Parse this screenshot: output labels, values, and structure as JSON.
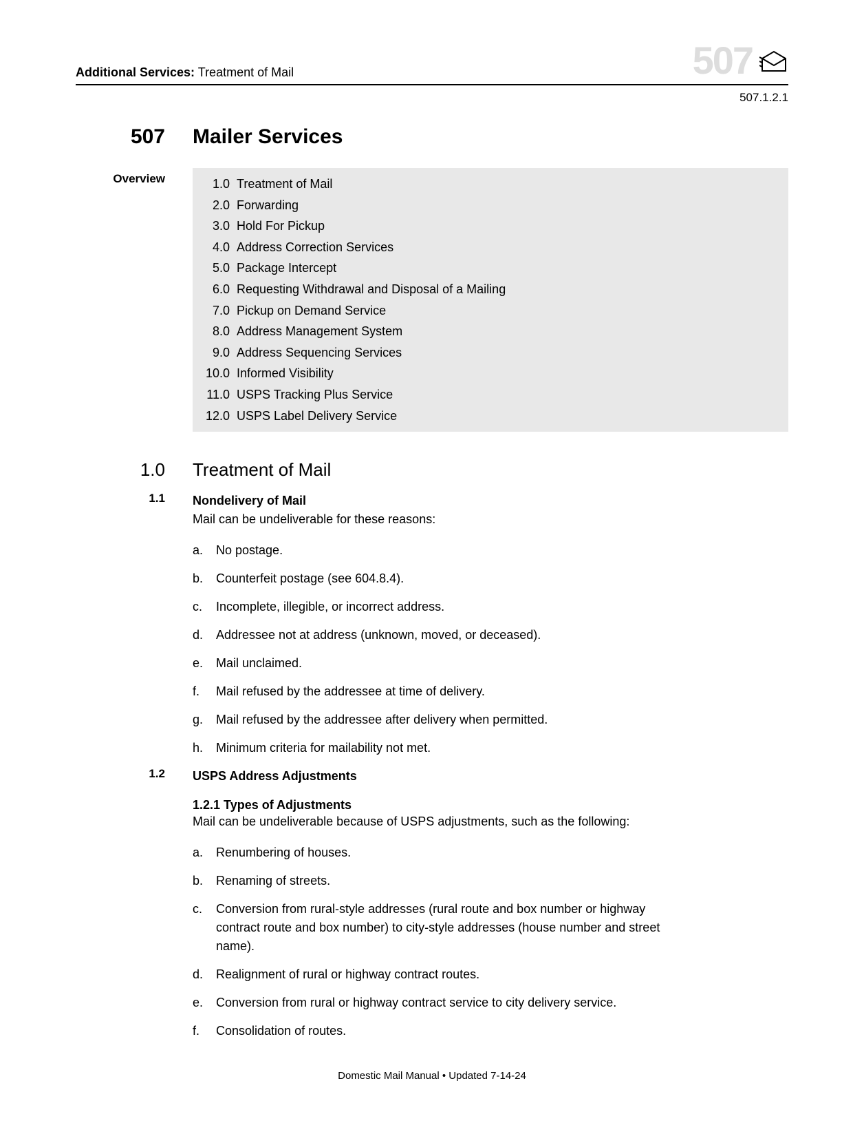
{
  "header": {
    "category_bold": "Additional Services:",
    "category_rest": " Treatment of Mail",
    "big_number": "507",
    "section_ref": "507.1.2.1"
  },
  "chapter": {
    "number": "507",
    "title": "Mailer Services"
  },
  "overview": {
    "label": "Overview",
    "items": [
      {
        "num": "1.0",
        "text": "Treatment of Mail"
      },
      {
        "num": "2.0",
        "text": "Forwarding"
      },
      {
        "num": "3.0",
        "text": "Hold For Pickup"
      },
      {
        "num": "4.0",
        "text": "Address Correction Services"
      },
      {
        "num": "5.0",
        "text": "Package Intercept"
      },
      {
        "num": "6.0",
        "text": "Requesting Withdrawal and Disposal of a Mailing"
      },
      {
        "num": "7.0",
        "text": "Pickup on Demand Service"
      },
      {
        "num": "8.0",
        "text": "Address Management System"
      },
      {
        "num": "9.0",
        "text": "Address Sequencing Services"
      },
      {
        "num": "10.0",
        "text": "Informed Visibility"
      },
      {
        "num": "11.0",
        "text": "USPS Tracking Plus Service"
      },
      {
        "num": "12.0",
        "text": "USPS Label Delivery Service"
      }
    ]
  },
  "section_1_0": {
    "number": "1.0",
    "title": "Treatment of Mail"
  },
  "section_1_1": {
    "number": "1.1",
    "heading": "Nondelivery of Mail",
    "intro": "Mail can be undeliverable for these reasons:",
    "items": [
      {
        "marker": "a.",
        "text": "No postage."
      },
      {
        "marker": "b.",
        "text": "Counterfeit postage (see 604.8.4)."
      },
      {
        "marker": "c.",
        "text": "Incomplete, illegible, or incorrect address."
      },
      {
        "marker": "d.",
        "text": "Addressee not at address (unknown, moved, or deceased)."
      },
      {
        "marker": "e.",
        "text": "Mail unclaimed."
      },
      {
        "marker": "f.",
        "text": "Mail refused by the addressee at time of delivery."
      },
      {
        "marker": "g.",
        "text": "Mail refused by the addressee after delivery when permitted."
      },
      {
        "marker": "h.",
        "text": "Minimum criteria for mailability not met."
      }
    ]
  },
  "section_1_2": {
    "number": "1.2",
    "heading": "USPS Address Adjustments"
  },
  "section_1_2_1": {
    "heading": "1.2.1  Types of Adjustments",
    "intro": "Mail can be undeliverable because of USPS adjustments, such as the following:",
    "items": [
      {
        "marker": "a.",
        "text": "Renumbering of houses."
      },
      {
        "marker": "b.",
        "text": "Renaming of streets."
      },
      {
        "marker": "c.",
        "text": "Conversion from rural-style addresses (rural route and box number or highway contract route and box number) to city-style addresses (house number and street name)."
      },
      {
        "marker": "d.",
        "text": "Realignment of rural or highway contract routes."
      },
      {
        "marker": "e.",
        "text": "Conversion from rural or highway contract service to city delivery service."
      },
      {
        "marker": "f.",
        "text": "Consolidation of routes."
      }
    ]
  },
  "footer": {
    "text": "Domestic Mail Manual • Updated 7-14-24"
  }
}
